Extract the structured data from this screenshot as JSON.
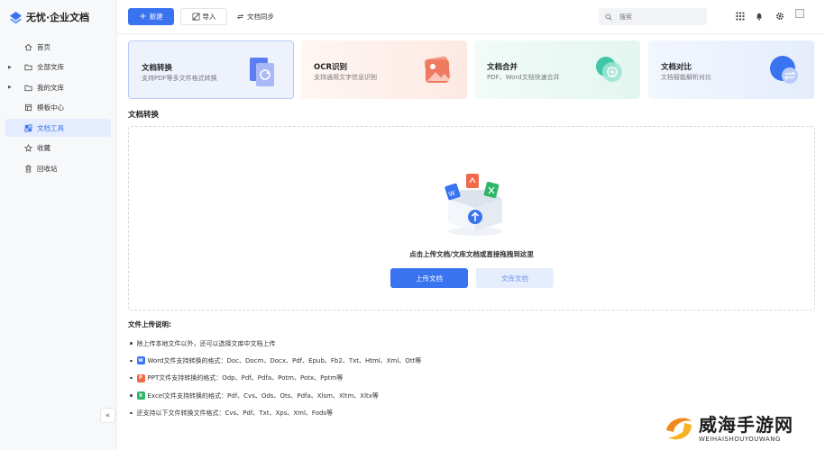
{
  "app": {
    "title": "无忧·企业文档"
  },
  "sidebar": {
    "items": [
      {
        "label": "首页",
        "icon": "home-icon",
        "caret": false,
        "active": false
      },
      {
        "label": "全部文库",
        "icon": "folder-icon",
        "caret": true,
        "active": false
      },
      {
        "label": "我的文库",
        "icon": "folder-icon",
        "caret": true,
        "active": false
      },
      {
        "label": "模板中心",
        "icon": "template-icon",
        "caret": false,
        "active": false
      },
      {
        "label": "文档工具",
        "icon": "tools-icon",
        "caret": false,
        "active": true
      },
      {
        "label": "收藏",
        "icon": "star-icon",
        "caret": false,
        "active": false
      },
      {
        "label": "回收站",
        "icon": "trash-icon",
        "caret": false,
        "active": false
      }
    ],
    "collapse_label": "«"
  },
  "toolbar": {
    "new_label": "新建",
    "import_label": "导入",
    "sync_label": "文档同步",
    "search_placeholder": "搜索"
  },
  "tools": [
    {
      "title": "文档转换",
      "desc": "支持PDF等多文件格式转换",
      "selected": true
    },
    {
      "title": "OCR识别",
      "desc": "支持通用文字信息识别",
      "selected": false
    },
    {
      "title": "文档合并",
      "desc": "PDF、Word文档快速合并",
      "selected": false
    },
    {
      "title": "文档对比",
      "desc": "文档智能解析对比",
      "selected": false
    }
  ],
  "section": {
    "title": "文档转换",
    "drop_hint": "点击上传文档/文库文档或直接拖拽到这里",
    "upload_label": "上传文档",
    "library_label": "文库文档"
  },
  "notes": {
    "title": "文件上传说明:",
    "items": [
      {
        "text": "除上传本地文件以外，还可以选择文库中文档上传",
        "badge": null
      },
      {
        "text": "Word文件支持转换的格式：Doc、Docm、Docx、Pdf、Epub、Fb2、Txt、Html、Xml、Ott等",
        "badge": "W"
      },
      {
        "text": "PPT文件支持转换的格式：Odp、Pdf、Pdfa、Potm、Potx、Pptm等",
        "badge": "P"
      },
      {
        "text": "Excel文件支持转换的格式：Pdf、Cvs、Ods、Ots、Pdfa、Xlsm、Xltm、Xltx等",
        "badge": "X"
      },
      {
        "text": "还支持以下文件转换文件格式：Cvs、Pdf、Txt、Xps、Xml、Fods等",
        "badge": null
      }
    ]
  },
  "watermark": {
    "title": "威海手游网",
    "subtitle": "WEIHAISHOUYOUWANG"
  },
  "colors": {
    "primary": "#3a73f0",
    "word": "#3a73f0",
    "ppt": "#f06a4a",
    "excel": "#2fb66a"
  }
}
